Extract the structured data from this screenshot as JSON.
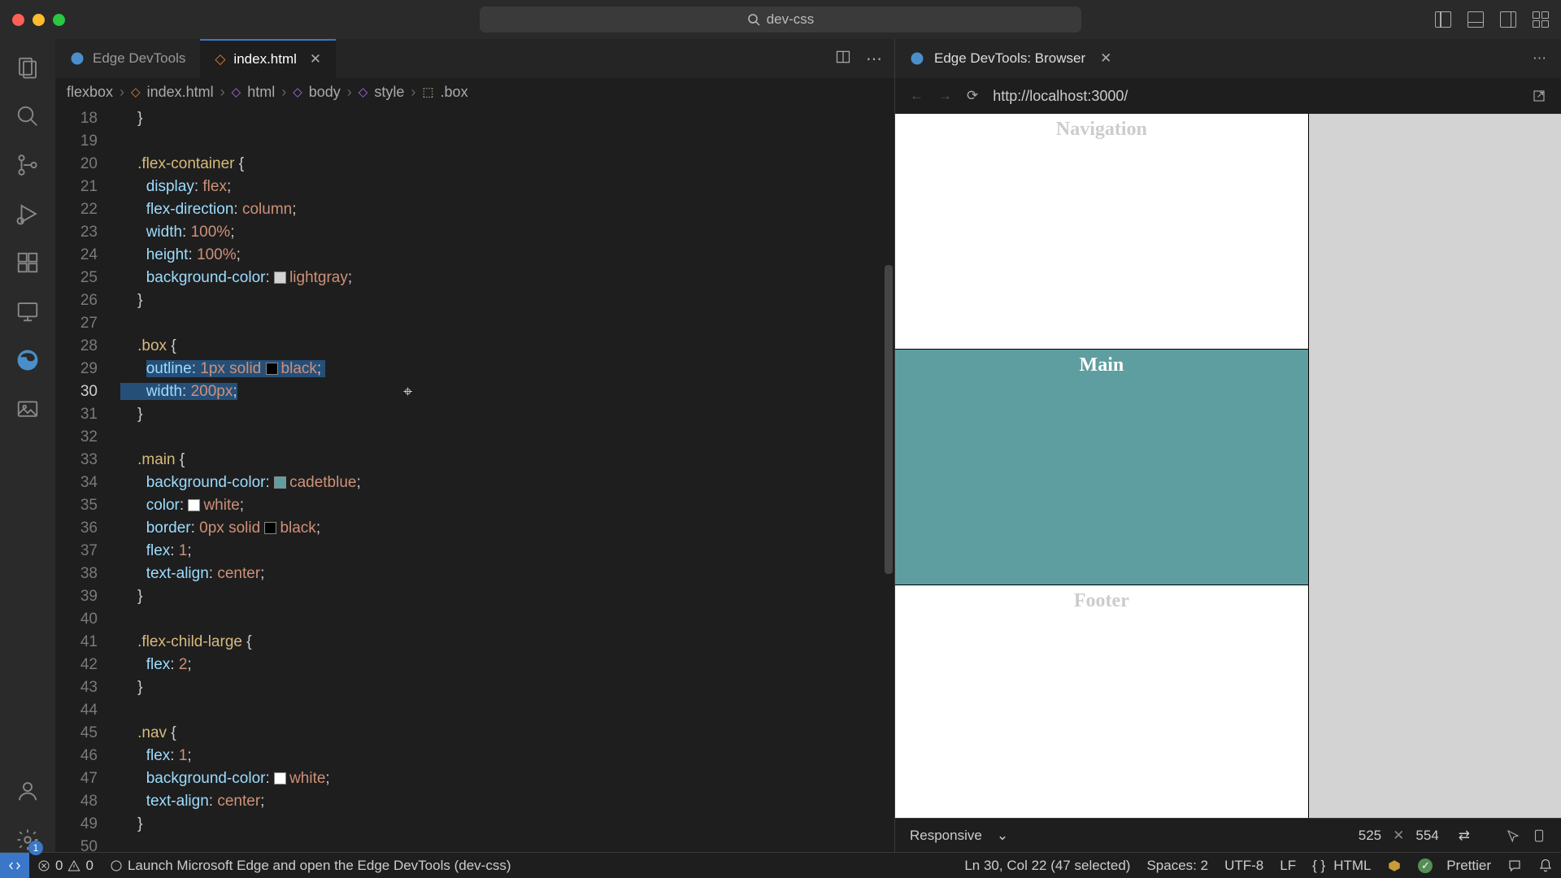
{
  "title_search": "dev-css",
  "tabs": [
    {
      "label": "Edge DevTools",
      "icon_color": "#3a8de0",
      "active": false
    },
    {
      "label": "index.html",
      "icon_color": "#e37933",
      "active": true
    }
  ],
  "breadcrumb": [
    "flexbox",
    "index.html",
    "html",
    "body",
    "style",
    ".box"
  ],
  "breadcrumb_icons": [
    "",
    "◇",
    "◇",
    "◇",
    "◇",
    "⬚"
  ],
  "gutter": [
    "18",
    "19",
    "20",
    "21",
    "22",
    "23",
    "24",
    "25",
    "26",
    "27",
    "28",
    "29",
    "30",
    "31",
    "32",
    "33",
    "34",
    "35",
    "36",
    "37",
    "38",
    "39",
    "40",
    "41",
    "42",
    "43",
    "44",
    "45",
    "46",
    "47",
    "48",
    "49",
    "50"
  ],
  "gutter_current": "30",
  "code": {
    "l18": "    }",
    "l19": "",
    "l20_sel": ".flex-container",
    "l21_p": "display",
    "l21_v": "flex",
    "l22_p": "flex-direction",
    "l22_v": "column",
    "l23_p": "width",
    "l23_v": "100%",
    "l24_p": "height",
    "l24_v": "100%",
    "l25_p": "background-color",
    "l25_v": "lightgray",
    "l25_sw": "#d3d3d3",
    "l26": "    }",
    "l27": "",
    "l28_sel": ".box",
    "l29_p": "outline",
    "l29_v1": "1px",
    "l29_v2": "solid",
    "l29_v3": "black",
    "l29_sw": "#000",
    "l30_p": "width",
    "l30_v": "200px",
    "l31": "    }",
    "l32": "",
    "l33_sel": ".main",
    "l34_p": "background-color",
    "l34_v": "cadetblue",
    "l34_sw": "#5f9ea0",
    "l35_p": "color",
    "l35_v": "white",
    "l35_sw": "#fff",
    "l36_p": "border",
    "l36_v1": "0px",
    "l36_v2": "solid",
    "l36_v3": "black",
    "l36_sw": "#000",
    "l37_p": "flex",
    "l37_v": "1",
    "l38_p": "text-align",
    "l38_v": "center",
    "l39": "    }",
    "l40": "",
    "l41_sel": ".flex-child-large",
    "l42_p": "flex",
    "l42_v": "2",
    "l43": "    }",
    "l44": "",
    "l45_sel": ".nav",
    "l46_p": "flex",
    "l46_v": "1",
    "l47_p": "background-color",
    "l47_v": "white",
    "l47_sw": "#fff",
    "l48_p": "text-align",
    "l48_v": "center",
    "l49": "    }",
    "l50": ""
  },
  "devtools": {
    "tab_label": "Edge DevTools: Browser",
    "url": "http://localhost:3000/",
    "page": {
      "nav": "Navigation",
      "main": "Main",
      "footer": "Footer"
    },
    "responsive": "Responsive",
    "width": "525",
    "height": "554"
  },
  "statusbar": {
    "errors": "0",
    "warnings": "0",
    "msg": "Launch Microsoft Edge and open the Edge DevTools (dev-css)",
    "cursor": "Ln 30, Col 22 (47 selected)",
    "spaces": "Spaces: 2",
    "encoding": "UTF-8",
    "eol": "LF",
    "lang": "HTML",
    "prettier": "Prettier"
  },
  "gear_badge": "1"
}
